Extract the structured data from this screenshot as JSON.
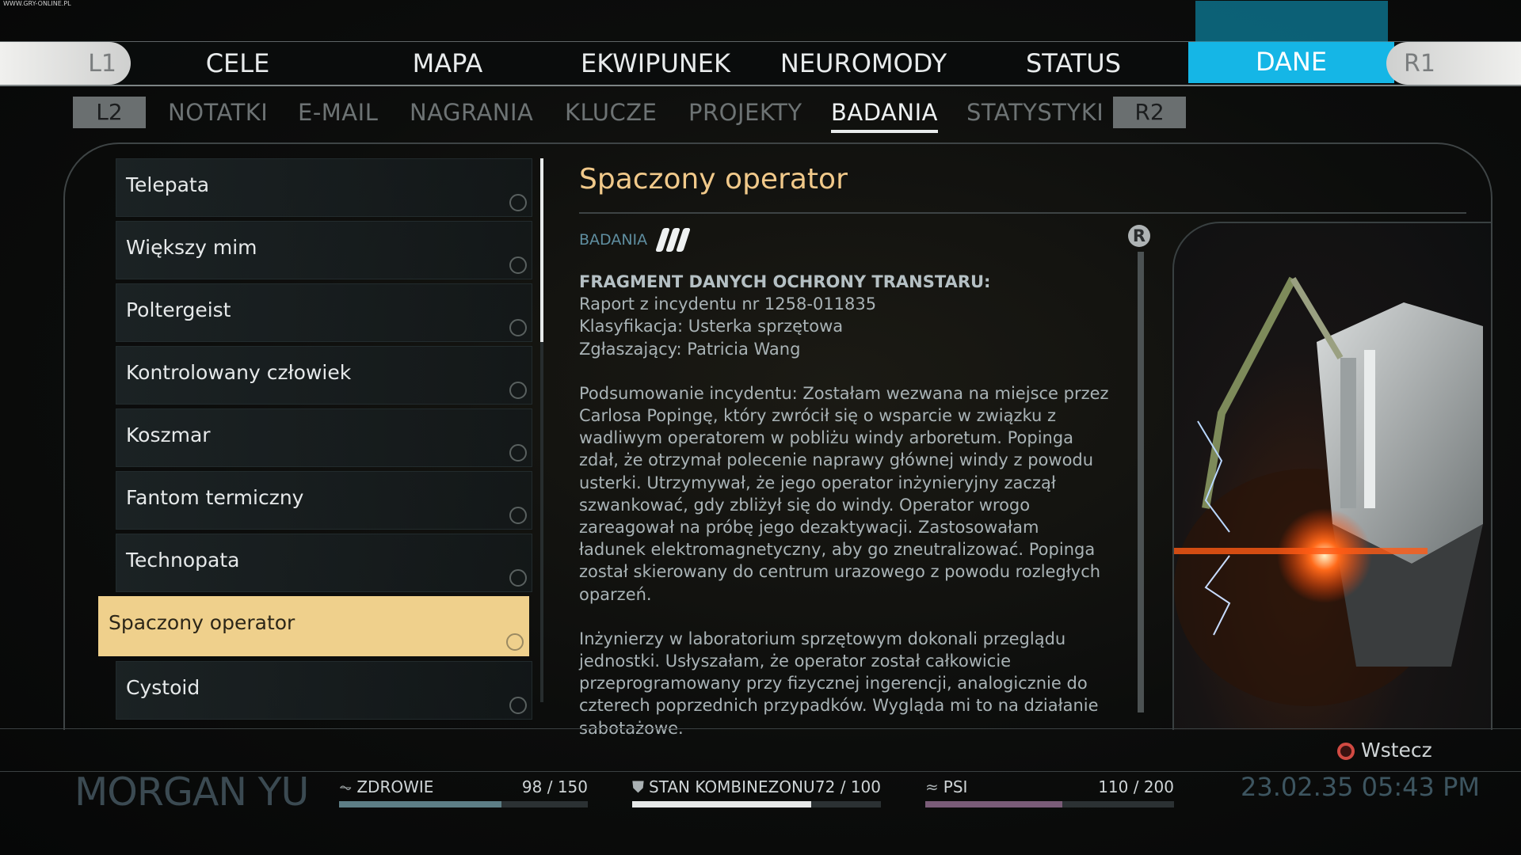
{
  "watermark": "WWW.GRY-ONLINE.PL",
  "main_nav": {
    "left_shoulder": "L1",
    "right_shoulder": "R1",
    "tabs": [
      "CELE",
      "MAPA",
      "EKWIPUNEK",
      "NEUROMODY",
      "STATUS",
      "DANE"
    ],
    "active_tab": "DANE"
  },
  "sub_nav": {
    "left_button": "L2",
    "right_button": "R2",
    "tabs": [
      "NOTATKI",
      "E-MAIL",
      "NAGRANIA",
      "KLUCZE",
      "PROJEKTY",
      "BADANIA",
      "STATYSTYKI"
    ],
    "active_tab": "BADANIA"
  },
  "list": {
    "items": [
      {
        "label": "Telepata"
      },
      {
        "label": "Większy mim"
      },
      {
        "label": "Poltergeist"
      },
      {
        "label": "Kontrolowany człowiek"
      },
      {
        "label": "Koszmar"
      },
      {
        "label": "Fantom termiczny"
      },
      {
        "label": "Technopata"
      },
      {
        "label": "Spaczony operator"
      },
      {
        "label": "Cystoid"
      }
    ],
    "selected_index": 7
  },
  "detail": {
    "title": "Spaczony operator",
    "category": "BADANIA",
    "research_level": 3,
    "r_button": "R",
    "heading": "FRAGMENT DANYCH OCHRONY TRANSTARU:",
    "meta_lines": [
      "Raport z incydentu nr 1258-011835",
      "Klasyfikacja: Usterka sprzętowa",
      "Zgłaszający: Patricia Wang"
    ],
    "paragraph1": "Podsumowanie incydentu: Zostałam wezwana na miejsce przez Carlosa Popingę, który zwrócił się o wsparcie w związku z wadliwym operatorem w pobliżu windy arboretum. Popinga zdał, że otrzymał polecenie naprawy głównej windy z powodu usterki. Utrzymywał, że jego operator inżynieryjny zaczął szwankować, gdy zbliżył się do windy. Operator wrogo zareagował na próbę jego dezaktywacji. Zastosowałam ładunek elektromagnetyczny, aby go zneutralizować. Popinga został skierowany do centrum urazowego z powodu rozległych oparzeń.",
    "paragraph2": "Inżynierzy w laboratorium sprzętowym dokonali przeglądu jednostki. Usłyszałam, że operator został całkowicie przeprogramowany przy fizycznej ingerencji, analogicznie do czterech poprzednich przypadków. Wygląda mi to na działanie sabotażowe."
  },
  "footer": {
    "back_label": "Wstecz",
    "player_name": "MORGAN YU",
    "stats": {
      "health": {
        "label": "ZDROWIE",
        "value_text": "98 / 150",
        "current": 98,
        "max": 150,
        "color": "#5d7e86"
      },
      "suit": {
        "label": "STAN KOMBINEZONU",
        "value_text": "72 / 100",
        "current": 72,
        "max": 100,
        "color": "#e6e8e8"
      },
      "psi": {
        "label": "PSI",
        "value_text": "110 / 200",
        "current": 110,
        "max": 200,
        "color": "#7a5c78"
      }
    },
    "datetime": "23.02.35 05:43 PM"
  },
  "colors": {
    "accent_blue": "#15b6e6",
    "selected_item": "#efd08c",
    "title_orange": "#f1c98a",
    "category_blue": "#5f8ea0"
  }
}
